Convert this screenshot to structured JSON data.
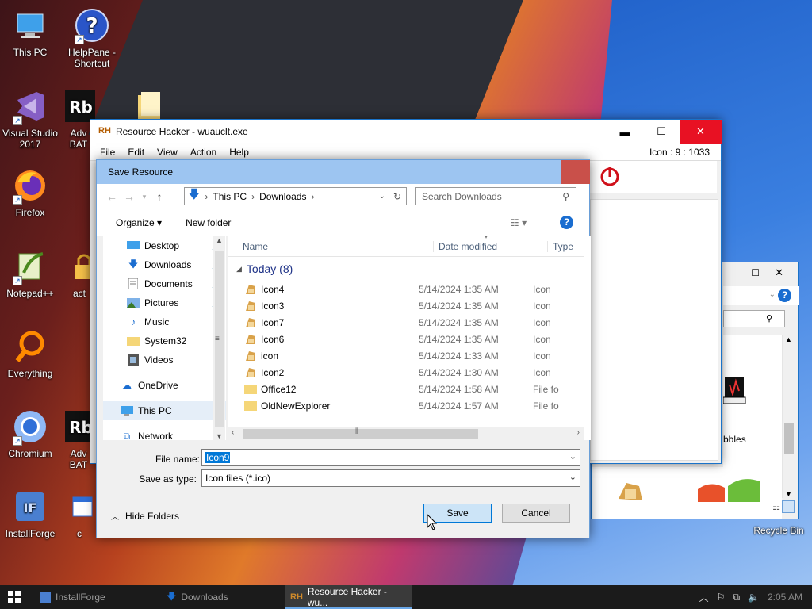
{
  "desktop": {
    "icons": [
      {
        "label": "This PC",
        "sublabel": ""
      },
      {
        "label": "HelpPane -",
        "sublabel": "Shortcut"
      },
      {
        "label": "Visual Studio",
        "sublabel": "2017"
      },
      {
        "label": "Adv",
        "sublabel": "BAT"
      },
      {
        "label": "Firefox",
        "sublabel": ""
      },
      {
        "label": "Notepad++",
        "sublabel": ""
      },
      {
        "label": "act",
        "sublabel": ""
      },
      {
        "label": "Everything",
        "sublabel": ""
      },
      {
        "label": "Chromium",
        "sublabel": ""
      },
      {
        "label": "Adv",
        "sublabel": "BAT"
      },
      {
        "label": "InstallForge",
        "sublabel": ""
      },
      {
        "label": "c",
        "sublabel": ""
      },
      {
        "label": "Recycle Bin",
        "sublabel": ""
      }
    ]
  },
  "rh_window": {
    "title": "Resource Hacker - wuauclt.exe",
    "menu": [
      "File",
      "Edit",
      "View",
      "Action",
      "Help"
    ],
    "status": "Icon : 9 : 1033",
    "controls": {
      "minimize": "▬",
      "maximize": "☐",
      "close": "✕"
    }
  },
  "bg_explorer": {
    "item_label": "bbles"
  },
  "dialog": {
    "title": "Save Resource",
    "breadcrumb": [
      "This PC",
      "Downloads"
    ],
    "search_placeholder": "Search Downloads",
    "organize_label": "Organize ▾",
    "new_folder_label": "New folder",
    "nav": [
      {
        "label": "Desktop",
        "icon": "desktop-icon",
        "pinned": true
      },
      {
        "label": "Downloads",
        "icon": "download-icon",
        "pinned": true
      },
      {
        "label": "Documents",
        "icon": "documents-icon",
        "pinned": true
      },
      {
        "label": "Pictures",
        "icon": "pictures-icon",
        "pinned": true
      },
      {
        "label": "Music",
        "icon": "music-icon",
        "pinned": false
      },
      {
        "label": "System32",
        "icon": "folder-icon",
        "pinned": false
      },
      {
        "label": "Videos",
        "icon": "videos-icon",
        "pinned": false
      },
      {
        "label": "OneDrive",
        "icon": "cloud-icon",
        "pinned": false
      },
      {
        "label": "This PC",
        "icon": "computer-icon",
        "pinned": false
      },
      {
        "label": "Network",
        "icon": "network-icon",
        "pinned": false
      }
    ],
    "columns": [
      "Name",
      "Date modified",
      "Type"
    ],
    "group_label": "Today (8)",
    "files": [
      {
        "name": "Icon4",
        "date": "5/14/2024 1:35 AM",
        "type": "Icon",
        "kind": "icon"
      },
      {
        "name": "Icon3",
        "date": "5/14/2024 1:35 AM",
        "type": "Icon",
        "kind": "icon"
      },
      {
        "name": "Icon7",
        "date": "5/14/2024 1:35 AM",
        "type": "Icon",
        "kind": "icon"
      },
      {
        "name": "Icon6",
        "date": "5/14/2024 1:35 AM",
        "type": "Icon",
        "kind": "icon"
      },
      {
        "name": "icon",
        "date": "5/14/2024 1:33 AM",
        "type": "Icon",
        "kind": "icon"
      },
      {
        "name": "Icon2",
        "date": "5/14/2024 1:30 AM",
        "type": "Icon",
        "kind": "icon"
      },
      {
        "name": "Office12",
        "date": "5/14/2024 1:58 AM",
        "type": "File fo",
        "kind": "folder"
      },
      {
        "name": "OldNewExplorer",
        "date": "5/14/2024 1:57 AM",
        "type": "File fo",
        "kind": "folder"
      }
    ],
    "file_name_label": "File name:",
    "file_name_value": "Icon9",
    "save_as_type_label": "Save as type:",
    "save_as_type_value": "Icon files (*.ico)",
    "hide_folders_label": "Hide Folders",
    "save_label": "Save",
    "cancel_label": "Cancel"
  },
  "taskbar": {
    "items": [
      "InstallForge",
      "Downloads",
      "Resource Hacker - wu..."
    ],
    "clock": "2:05 AM"
  },
  "colors": {
    "dialog_title_bg": "#9dc5f1",
    "accent": "#1a73c9",
    "close_red": "#c9504a"
  }
}
